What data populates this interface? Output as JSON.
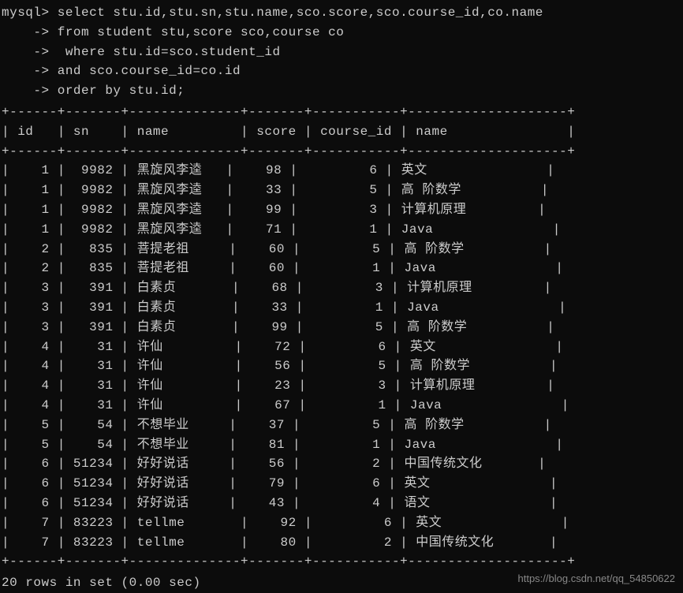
{
  "prompt": "mysql>",
  "continuation": "    ->",
  "query_lines": [
    " select stu.id,stu.sn,stu.name,sco.score,sco.course_id,co.name",
    " from student stu,score sco,course co",
    "  where stu.id=sco.student_id",
    " and sco.course_id=co.id",
    " order by stu.id;"
  ],
  "table": {
    "border": "+------+-------+--------------+-------+-----------+--------------------+",
    "header": "| id   | sn    | name         | score | course_id | name               |",
    "columns": [
      "id",
      "sn",
      "name",
      "score",
      "course_id",
      "name"
    ],
    "rows": [
      {
        "id": "1",
        "sn": "9982",
        "name": "黑旋风李逵",
        "score": "98",
        "course_id": "6",
        "course_name": "英文"
      },
      {
        "id": "1",
        "sn": "9982",
        "name": "黑旋风李逵",
        "score": "33",
        "course_id": "5",
        "course_name": "高 阶数学"
      },
      {
        "id": "1",
        "sn": "9982",
        "name": "黑旋风李逵",
        "score": "99",
        "course_id": "3",
        "course_name": "计算机原理"
      },
      {
        "id": "1",
        "sn": "9982",
        "name": "黑旋风李逵",
        "score": "71",
        "course_id": "1",
        "course_name": "Java"
      },
      {
        "id": "2",
        "sn": "835",
        "name": "菩提老祖",
        "score": "60",
        "course_id": "5",
        "course_name": "高 阶数学"
      },
      {
        "id": "2",
        "sn": "835",
        "name": "菩提老祖",
        "score": "60",
        "course_id": "1",
        "course_name": "Java"
      },
      {
        "id": "3",
        "sn": "391",
        "name": "白素贞",
        "score": "68",
        "course_id": "3",
        "course_name": "计算机原理"
      },
      {
        "id": "3",
        "sn": "391",
        "name": "白素贞",
        "score": "33",
        "course_id": "1",
        "course_name": "Java"
      },
      {
        "id": "3",
        "sn": "391",
        "name": "白素贞",
        "score": "99",
        "course_id": "5",
        "course_name": "高 阶数学"
      },
      {
        "id": "4",
        "sn": "31",
        "name": "许仙",
        "score": "72",
        "course_id": "6",
        "course_name": "英文"
      },
      {
        "id": "4",
        "sn": "31",
        "name": "许仙",
        "score": "56",
        "course_id": "5",
        "course_name": "高 阶数学"
      },
      {
        "id": "4",
        "sn": "31",
        "name": "许仙",
        "score": "23",
        "course_id": "3",
        "course_name": "计算机原理"
      },
      {
        "id": "4",
        "sn": "31",
        "name": "许仙",
        "score": "67",
        "course_id": "1",
        "course_name": "Java"
      },
      {
        "id": "5",
        "sn": "54",
        "name": "不想毕业",
        "score": "37",
        "course_id": "5",
        "course_name": "高 阶数学"
      },
      {
        "id": "5",
        "sn": "54",
        "name": "不想毕业",
        "score": "81",
        "course_id": "1",
        "course_name": "Java"
      },
      {
        "id": "6",
        "sn": "51234",
        "name": "好好说话",
        "score": "56",
        "course_id": "2",
        "course_name": "中国传统文化"
      },
      {
        "id": "6",
        "sn": "51234",
        "name": "好好说话",
        "score": "79",
        "course_id": "6",
        "course_name": "英文"
      },
      {
        "id": "6",
        "sn": "51234",
        "name": "好好说话",
        "score": "43",
        "course_id": "4",
        "course_name": "语文"
      },
      {
        "id": "7",
        "sn": "83223",
        "name": "tellme",
        "score": "92",
        "course_id": "6",
        "course_name": "英文"
      },
      {
        "id": "7",
        "sn": "83223",
        "name": "tellme",
        "score": "80",
        "course_id": "2",
        "course_name": "中国传统文化"
      }
    ]
  },
  "footer": "20 rows in set (0.00 sec)",
  "watermark": "https://blog.csdn.net/qq_54850622",
  "chart_data": {
    "type": "table",
    "title": "MySQL query result: student scores with course info",
    "columns": [
      "id",
      "sn",
      "name",
      "score",
      "course_id",
      "name"
    ],
    "rows": [
      [
        1,
        9982,
        "黑旋风李逵",
        98,
        6,
        "英文"
      ],
      [
        1,
        9982,
        "黑旋风李逵",
        33,
        5,
        "高 阶数学"
      ],
      [
        1,
        9982,
        "黑旋风李逵",
        99,
        3,
        "计算机原理"
      ],
      [
        1,
        9982,
        "黑旋风李逵",
        71,
        1,
        "Java"
      ],
      [
        2,
        835,
        "菩提老祖",
        60,
        5,
        "高 阶数学"
      ],
      [
        2,
        835,
        "菩提老祖",
        60,
        1,
        "Java"
      ],
      [
        3,
        391,
        "白素贞",
        68,
        3,
        "计算机原理"
      ],
      [
        3,
        391,
        "白素贞",
        33,
        1,
        "Java"
      ],
      [
        3,
        391,
        "白素贞",
        99,
        5,
        "高 阶数学"
      ],
      [
        4,
        31,
        "许仙",
        72,
        6,
        "英文"
      ],
      [
        4,
        31,
        "许仙",
        56,
        5,
        "高 阶数学"
      ],
      [
        4,
        31,
        "许仙",
        23,
        3,
        "计算机原理"
      ],
      [
        4,
        31,
        "许仙",
        67,
        1,
        "Java"
      ],
      [
        5,
        54,
        "不想毕业",
        37,
        5,
        "高 阶数学"
      ],
      [
        5,
        54,
        "不想毕业",
        81,
        1,
        "Java"
      ],
      [
        6,
        51234,
        "好好说话",
        56,
        2,
        "中国传统文化"
      ],
      [
        6,
        51234,
        "好好说话",
        79,
        6,
        "英文"
      ],
      [
        6,
        51234,
        "好好说话",
        43,
        4,
        "语文"
      ],
      [
        7,
        83223,
        "tellme",
        92,
        6,
        "英文"
      ],
      [
        7,
        83223,
        "tellme",
        80,
        2,
        "中国传统文化"
      ]
    ]
  }
}
